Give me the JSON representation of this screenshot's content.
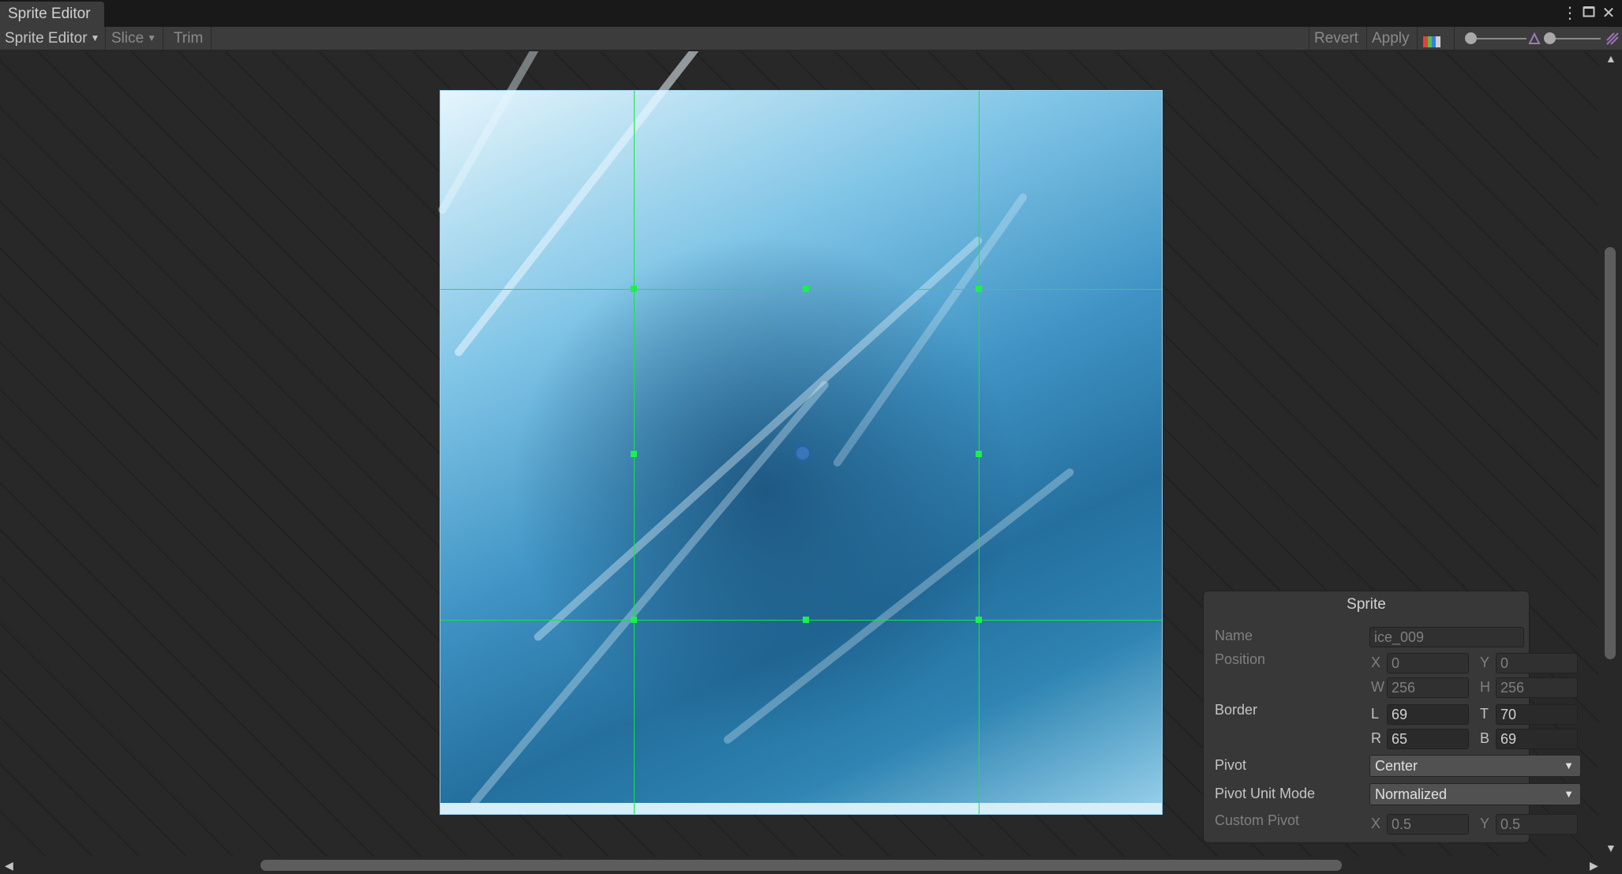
{
  "window": {
    "tab_title": "Sprite Editor",
    "controls": [
      {
        "icon": "kebab-menu-icon",
        "glyph": "⋮"
      },
      {
        "icon": "maximize-icon",
        "glyph": "🗖"
      },
      {
        "icon": "close-icon",
        "glyph": "✕"
      }
    ]
  },
  "toolbar": {
    "mode_label": "Sprite Editor",
    "slice_label": "Slice",
    "trim_label": "Trim",
    "revert_label": "Revert",
    "apply_label": "Apply",
    "color_channel_icon": "rgb-channel-icon",
    "zoom_slider_level": 0.05,
    "mip_slider_level": 0.2
  },
  "canvas": {
    "sprite_name": "ice_009",
    "border_color": "#19e24a",
    "pivot_color": "#2a5fb0"
  },
  "sprite_panel": {
    "title": "Sprite",
    "name_label": "Name",
    "name_value": "ice_009",
    "position_label": "Position",
    "x_label": "X",
    "x_value": "0",
    "y_label": "Y",
    "y_value": "0",
    "w_label": "W",
    "w_value": "256",
    "h_label": "H",
    "h_value": "256",
    "border_label": "Border",
    "l_label": "L",
    "l_value": "69",
    "t_label": "T",
    "t_value": "70",
    "r_label": "R",
    "r_value": "65",
    "b_label": "B",
    "b_value": "69",
    "pivot_label": "Pivot",
    "pivot_value": "Center",
    "pivot_unit_label": "Pivot Unit Mode",
    "pivot_unit_value": "Normalized",
    "custom_pivot_label": "Custom Pivot",
    "cp_x_label": "X",
    "cp_x_value": "0.5",
    "cp_y_label": "Y",
    "cp_y_value": "0.5"
  }
}
